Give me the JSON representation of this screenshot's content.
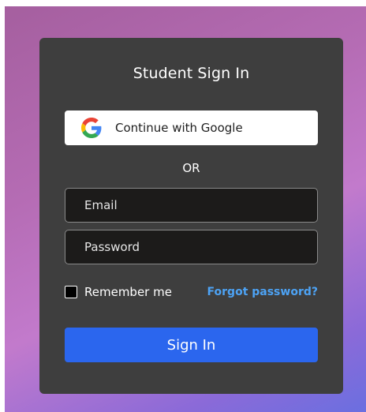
{
  "form": {
    "title": "Student Sign In",
    "google_button_label": "Continue with Google",
    "separator": "OR",
    "email_placeholder": "Email",
    "password_placeholder": "Password",
    "remember_label": "Remember me",
    "forgot_link": "Forgot password?",
    "submit_label": "Sign In"
  },
  "colors": {
    "card_background": "#3e3e3e",
    "primary_button": "#2b66ee",
    "link": "#4da3f5",
    "input_background": "#1c1b1a"
  },
  "icons": {
    "google": "google-icon"
  }
}
